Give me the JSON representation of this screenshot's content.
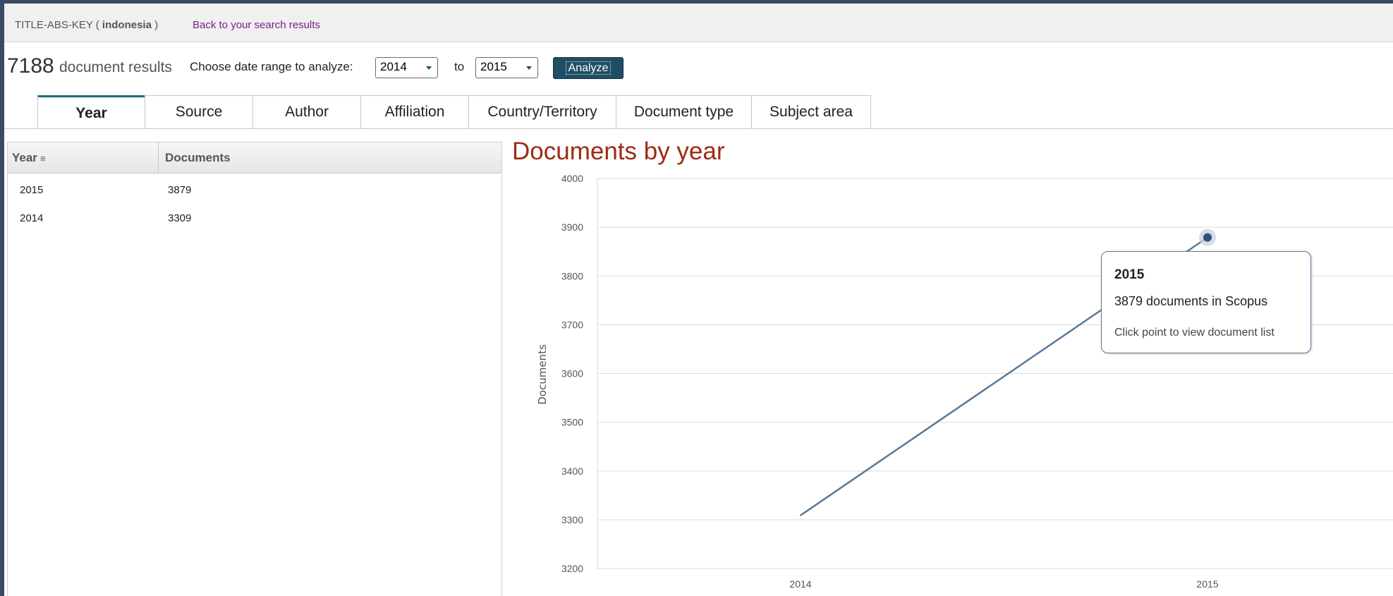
{
  "query": {
    "prefix": "TITLE-ABS-KEY ( ",
    "term": "indonesia",
    "suffix": " )",
    "back_link": "Back to your search results"
  },
  "results": {
    "count": "7188",
    "count_label": "document results",
    "range_label": "Choose date range to analyze:",
    "from_value": "2014",
    "to_label": "to",
    "to_value": "2015",
    "analyze_label": "Analyze"
  },
  "tabs": [
    {
      "label": "Year",
      "active": true
    },
    {
      "label": "Source"
    },
    {
      "label": "Author"
    },
    {
      "label": "Affiliation"
    },
    {
      "label": "Country/Territory"
    },
    {
      "label": "Document type"
    },
    {
      "label": "Subject area"
    }
  ],
  "table": {
    "headers": {
      "year": "Year",
      "sort_icon": "≡",
      "documents": "Documents"
    },
    "rows": [
      {
        "year": "2015",
        "documents": "3879"
      },
      {
        "year": "2014",
        "documents": "3309"
      }
    ]
  },
  "chart_title": "Documents by year",
  "tooltip": {
    "year": "2015",
    "text": "3879 documents in Scopus",
    "hint": "Click point to view document list"
  },
  "colors": {
    "line": "#5b7896",
    "title": "#9e2a14",
    "accent_tab": "#1c6e7d",
    "button": "#1f4f66"
  },
  "chart_data": {
    "type": "line",
    "x": [
      "2014",
      "2015"
    ],
    "series": [
      {
        "values": [
          3309,
          3879
        ]
      }
    ],
    "ylabel": "Documents",
    "ylim": [
      3200,
      4000
    ],
    "yticks": [
      3200,
      3300,
      3400,
      3500,
      3600,
      3700,
      3800,
      3900,
      4000
    ],
    "grid": true,
    "highlighted_point": "2015"
  }
}
